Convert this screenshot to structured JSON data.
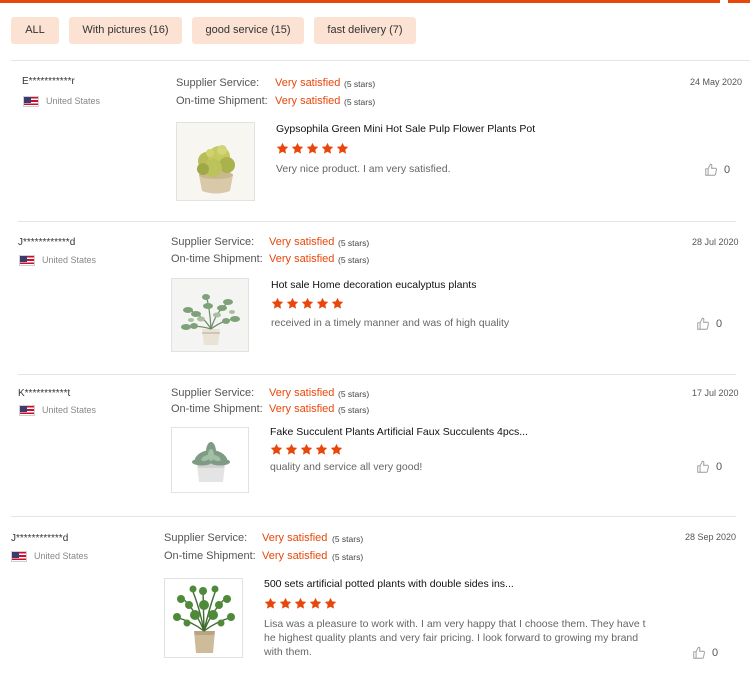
{
  "filters": [
    {
      "label": "ALL"
    },
    {
      "label": "With pictures (16)"
    },
    {
      "label": "good service (15)"
    },
    {
      "label": "fast delivery (7)"
    }
  ],
  "labels": {
    "supplier": "Supplier Service:",
    "shipment": "On-time Shipment:"
  },
  "colors": {
    "accent": "#e8470b",
    "chip_bg": "#fbe2d2"
  },
  "reviews": [
    {
      "user": "E***********r",
      "country": "United States",
      "supplier_value": "Very satisfied",
      "supplier_stars": "(5 stars)",
      "shipment_value": "Very satisfied",
      "shipment_stars": "(5 stars)",
      "date": "24 May 2020",
      "product_title": "Gypsophila Green Mini Hot Sale Pulp Flower Plants Pot",
      "rating": 5,
      "text": "Very nice product. I am very satisfied.",
      "likes": "0"
    },
    {
      "user": "J************d",
      "country": "United States",
      "supplier_value": "Very satisfied",
      "supplier_stars": "(5 stars)",
      "shipment_value": "Very satisfied",
      "shipment_stars": "(5 stars)",
      "date": "28 Jul 2020",
      "product_title": "Hot sale Home decoration eucalyptus plants",
      "rating": 5,
      "text": "received in a timely manner and was of high quality",
      "likes": "0"
    },
    {
      "user": "K***********t",
      "country": "United States",
      "supplier_value": "Very satisfied",
      "supplier_stars": "(5 stars)",
      "shipment_value": "Very satisfied",
      "shipment_stars": "(5 stars)",
      "date": "17 Jul 2020",
      "product_title": "Fake Succulent Plants Artificial Faux Succulents 4pcs...",
      "rating": 5,
      "text": "quality and service all very good!",
      "likes": "0"
    },
    {
      "user": "J************d",
      "country": "United States",
      "supplier_value": "Very satisfied",
      "supplier_stars": "(5 stars)",
      "shipment_value": "Very satisfied",
      "shipment_stars": "(5 stars)",
      "date": "28 Sep 2020",
      "product_title": "500 sets artificial potted plants with double sides ins...",
      "rating": 5,
      "text": "Lisa was a pleasure to work with. I am very happy that I choose them. They have t he highest quality plants and very fair pricing. I look forward to growing my brand with them.",
      "likes": "0"
    }
  ]
}
